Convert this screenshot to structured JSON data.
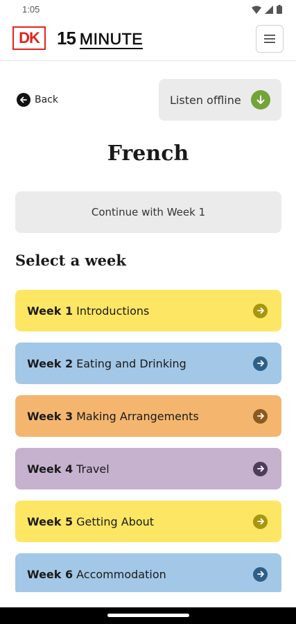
{
  "status_bar": {
    "time": "1:05"
  },
  "header": {
    "logo_text": "DK",
    "brand_number": "15",
    "brand_word": "MINUTE"
  },
  "nav": {
    "back_label": "Back",
    "listen_offline_label": "Listen offline"
  },
  "page": {
    "title": "French",
    "continue_label": "Continue with Week 1",
    "select_heading": "Select a week"
  },
  "weeks": [
    {
      "number": "Week 1",
      "name": "Introductions",
      "color": "#fde663",
      "arrow_color": "#a8960f"
    },
    {
      "number": "Week 2",
      "name": "Eating and Drinking",
      "color": "#a3c7e6",
      "arrow_color": "#2f5f87"
    },
    {
      "number": "Week 3",
      "name": "Making Arrangements",
      "color": "#f4b66f",
      "arrow_color": "#8c5a1f"
    },
    {
      "number": "Week 4",
      "name": "Travel",
      "color": "#c6b1cf",
      "arrow_color": "#4e3c5a"
    },
    {
      "number": "Week 5",
      "name": "Getting About",
      "color": "#fde663",
      "arrow_color": "#a8960f"
    },
    {
      "number": "Week 6",
      "name": "Accommodation",
      "color": "#a3c7e6",
      "arrow_color": "#2f5f87"
    }
  ],
  "colors": {
    "brand_red": "#e2231a",
    "listen_green": "#73a33a",
    "button_grey": "#ebebeb"
  }
}
